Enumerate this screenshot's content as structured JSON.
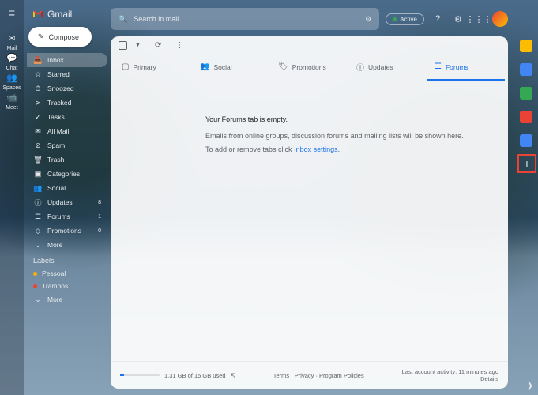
{
  "leftrail": {
    "items": [
      {
        "icon": "✉",
        "label": "Mail"
      },
      {
        "icon": "💬",
        "label": "Chat"
      },
      {
        "icon": "👥",
        "label": "Spaces"
      },
      {
        "icon": "📹",
        "label": "Meet"
      }
    ]
  },
  "logo": {
    "text": "Gmail"
  },
  "compose": {
    "label": "Compose"
  },
  "sidebar": {
    "items": [
      {
        "icon": "📥",
        "label": "Inbox",
        "active": true
      },
      {
        "icon": "☆",
        "label": "Starred"
      },
      {
        "icon": "⏱",
        "label": "Snoozed"
      },
      {
        "icon": "⊳",
        "label": "Tracked"
      },
      {
        "icon": "✓",
        "label": "Tasks"
      },
      {
        "icon": "✉",
        "label": "All Mail"
      },
      {
        "icon": "⊘",
        "label": "Spam"
      },
      {
        "icon": "🗑",
        "label": "Trash"
      },
      {
        "icon": "▣",
        "label": "Categories"
      },
      {
        "icon": "👥",
        "label": "Social"
      },
      {
        "icon": "ⓘ",
        "label": "Updates",
        "count": "8"
      },
      {
        "icon": "☰",
        "label": "Forums",
        "count": "1"
      },
      {
        "icon": "◇",
        "label": "Promotions",
        "count": "0"
      },
      {
        "icon": "⌄",
        "label": "More"
      }
    ],
    "labelsHeader": "Labels",
    "labels": [
      {
        "color": "#f4b400",
        "label": "Pessoal"
      },
      {
        "color": "#ea4335",
        "label": "Trampos"
      },
      {
        "icon": "⌄",
        "label": "More"
      }
    ]
  },
  "search": {
    "placeholder": "Search in mail"
  },
  "top": {
    "active": "Active"
  },
  "tabs": [
    {
      "icon": "▢",
      "label": "Primary"
    },
    {
      "icon": "👥",
      "label": "Social"
    },
    {
      "icon": "🏷",
      "label": "Promotions"
    },
    {
      "icon": "ⓘ",
      "label": "Updates"
    },
    {
      "icon": "☰",
      "label": "Forums",
      "selected": true
    }
  ],
  "empty": {
    "title": "Your Forums tab is empty.",
    "line1": "Emails from online groups, discussion forums and mailing lists will be shown here.",
    "line2_a": "To add or remove tabs click ",
    "line2_link": "Inbox settings"
  },
  "footer": {
    "storage": "1.31 GB of 15 GB used",
    "terms": "Terms",
    "privacy": "Privacy",
    "policies": "Program Policies",
    "activity": "Last account activity: 11 minutes ago",
    "details": "Details"
  },
  "rightapps": {
    "colors": [
      "#fbbc04",
      "#4285f4",
      "#34a853",
      "#ea4335",
      "#4285f4"
    ]
  }
}
